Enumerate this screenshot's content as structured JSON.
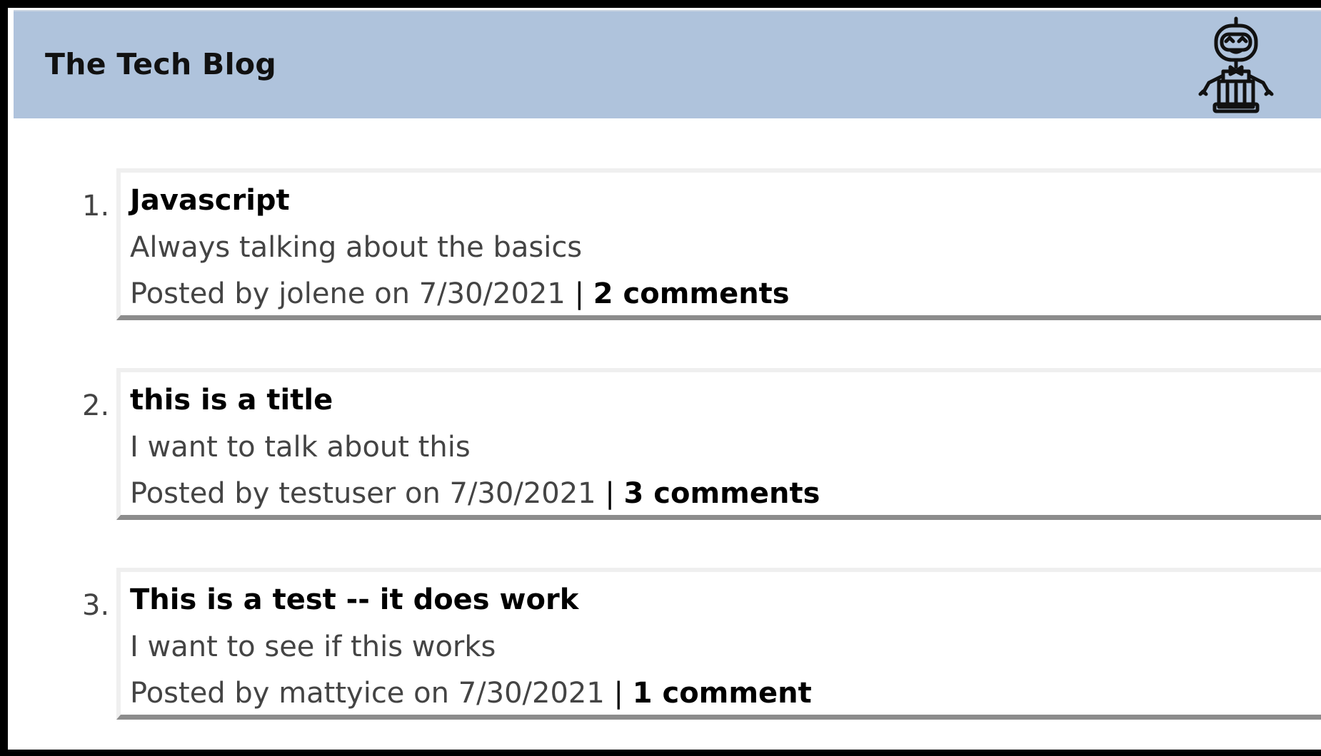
{
  "header": {
    "title": "The Tech Blog",
    "logo_icon": "robot-icon",
    "background_color": "#afc3dc"
  },
  "posts": [
    {
      "number": "1.",
      "title": "Javascript",
      "summary": "Always talking about the basics",
      "posted_by_prefix": "Posted by",
      "author": "jolene",
      "on": "on",
      "date": "7/30/2021",
      "separator": "|",
      "comments": "2 comments"
    },
    {
      "number": "2.",
      "title": "this is a title",
      "summary": "I want to talk about this",
      "posted_by_prefix": "Posted by",
      "author": "testuser",
      "on": "on",
      "date": "7/30/2021",
      "separator": "|",
      "comments": "3 comments"
    },
    {
      "number": "3.",
      "title": "This is a test -- it does work",
      "summary": "I want to see if this works",
      "posted_by_prefix": "Posted by",
      "author": "mattyice",
      "on": "on",
      "date": "7/30/2021",
      "separator": "|",
      "comments": "1 comment"
    }
  ]
}
